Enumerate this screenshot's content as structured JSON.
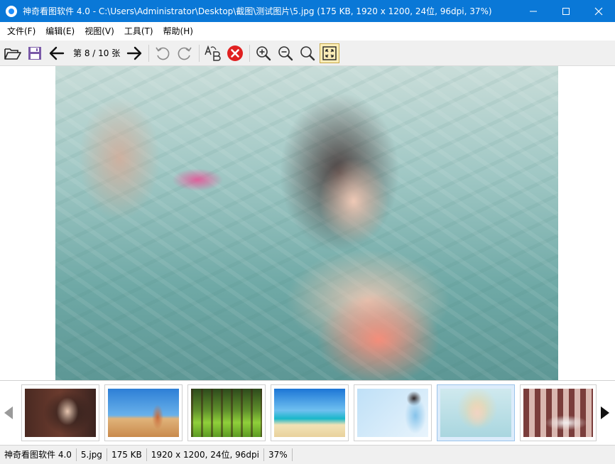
{
  "window": {
    "title": "神奇看图软件 4.0 - C:\\Users\\Administrator\\Desktop\\截图\\测试图片\\5.jpg (175 KB, 1920 x 1200, 24位, 96dpi, 37%)",
    "titlebar_color": "#0a78d7"
  },
  "menu": {
    "items": [
      {
        "label": "文件(F)"
      },
      {
        "label": "编辑(E)"
      },
      {
        "label": "视图(V)"
      },
      {
        "label": "工具(T)"
      },
      {
        "label": "帮助(H)"
      }
    ]
  },
  "toolbar": {
    "page_indicator": "第 8 / 10 张",
    "buttons": [
      {
        "icon": "folder-open-icon"
      },
      {
        "icon": "save-icon"
      },
      {
        "icon": "arrow-left-icon"
      },
      {
        "icon": "arrow-right-icon"
      },
      {
        "icon": "rotate-left-icon"
      },
      {
        "icon": "rotate-right-icon"
      },
      {
        "icon": "rename-icon"
      },
      {
        "icon": "delete-icon"
      },
      {
        "icon": "zoom-in-icon"
      },
      {
        "icon": "zoom-out-icon"
      },
      {
        "icon": "zoom-actual-icon"
      },
      {
        "icon": "fit-window-icon"
      }
    ]
  },
  "thumbnails": {
    "selected_index": 5,
    "count_visible": 7
  },
  "status": {
    "app": "神奇看图软件 4.0",
    "filename": "5.jpg",
    "size": "175 KB",
    "info": "1920 x 1200, 24位, 96dpi",
    "zoom": "37%"
  }
}
